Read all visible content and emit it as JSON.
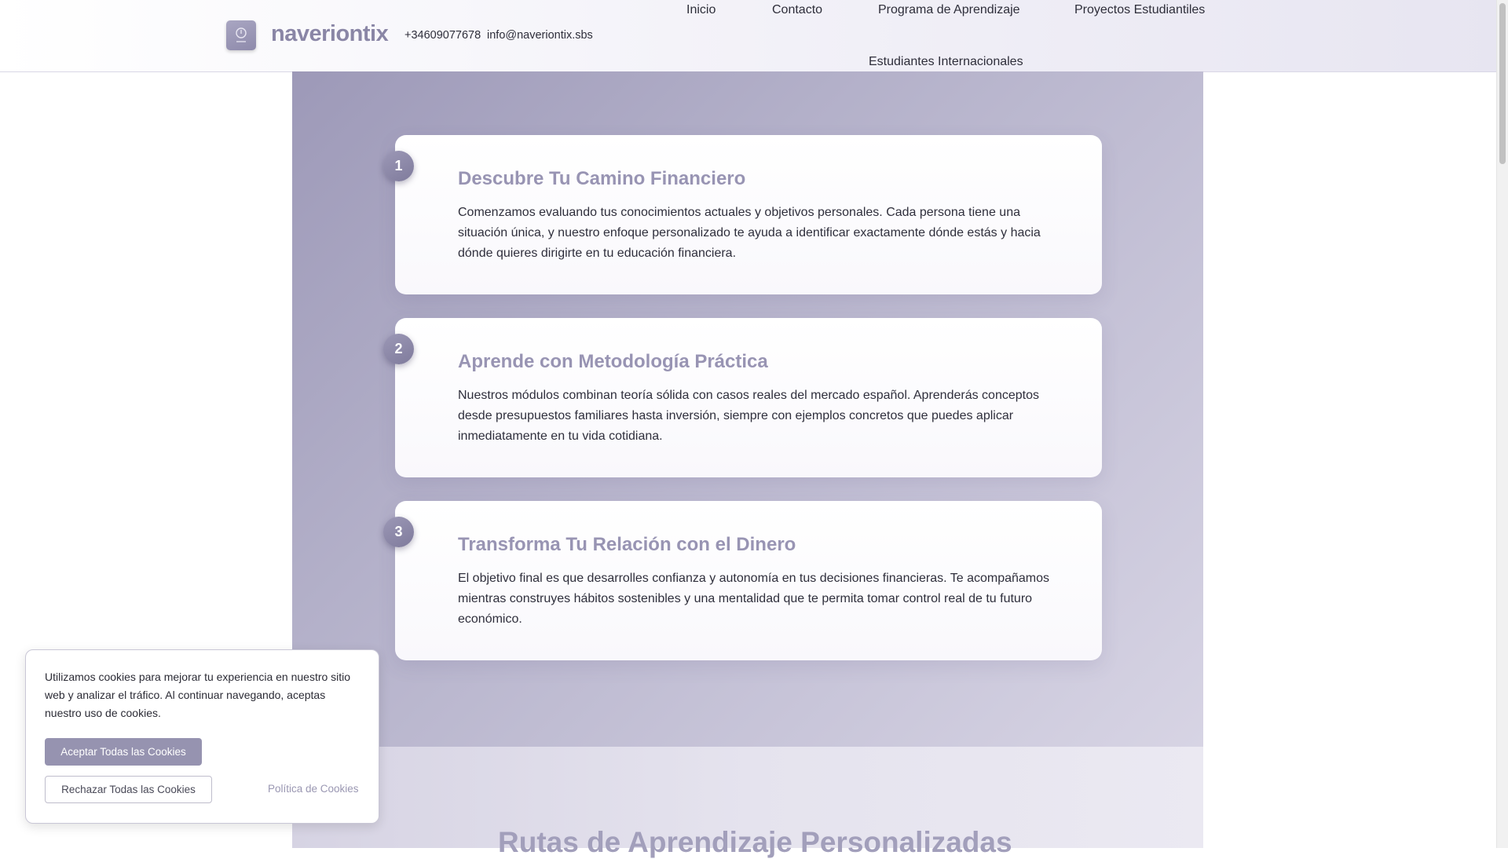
{
  "header": {
    "brand": "naveriontix",
    "phone": "+34609077678",
    "email": "info@naveriontix.sbs",
    "nav": [
      {
        "label": "Inicio"
      },
      {
        "label": "Contacto"
      },
      {
        "label": "Programa de Aprendizaje"
      },
      {
        "label": "Proyectos Estudiantiles"
      },
      {
        "label": "Estudiantes Internacionales"
      }
    ]
  },
  "steps": [
    {
      "number": "1",
      "title": "Descubre Tu Camino Financiero",
      "text": "Comenzamos evaluando tus conocimientos actuales y objetivos personales. Cada persona tiene una situación única, y nuestro enfoque personalizado te ayuda a identificar exactamente dónde estás y hacia dónde quieres dirigirte en tu educación financiera."
    },
    {
      "number": "2",
      "title": "Aprende con Metodología Práctica",
      "text": "Nuestros módulos combinan teoría sólida con casos reales del mercado español. Aprenderás conceptos desde presupuestos familiares hasta inversión, siempre con ejemplos concretos que puedes aplicar inmediatamente en tu vida cotidiana."
    },
    {
      "number": "3",
      "title": "Transforma Tu Relación con el Dinero",
      "text": "El objetivo final es que desarrolles confianza y autonomía en tus decisiones financieras. Te acompañamos mientras construyes hábitos sostenibles y una mentalidad que te permita tomar control real de tu futuro económico."
    }
  ],
  "next_section": {
    "title": "Rutas de Aprendizaje Personalizadas"
  },
  "cookie_banner": {
    "text": "Utilizamos cookies para mejorar tu experiencia en nuestro sitio web y analizar el tráfico. Al continuar navegando, aceptas nuestro uso de cookies.",
    "accept_label": "Aceptar Todas las Cookies",
    "reject_label": "Rechazar Todas las Cookies",
    "policy_label": "Política de Cookies"
  },
  "colors": {
    "accent": "#9894b3",
    "button": "#9693b0"
  }
}
